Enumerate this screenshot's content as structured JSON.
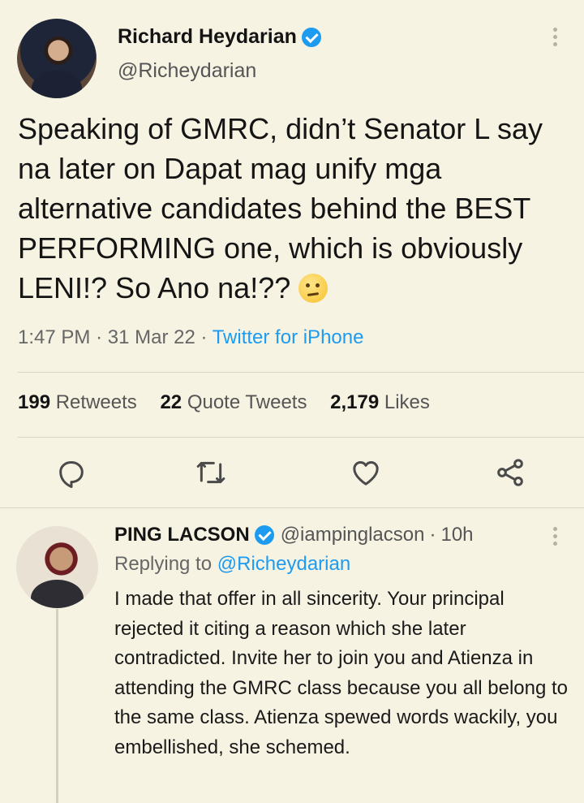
{
  "tweet": {
    "author_name": "Richard Heydarian",
    "author_handle": "@Richeydarian",
    "text": "Speaking of GMRC, didn’t Senator L say na later on Dapat mag unify mga alternative candidates behind the BEST PERFORMING one, which is obviously LENI!? So Ano na!??",
    "emoji": "face-with-rolling-eyes",
    "time": "1:47 PM",
    "date": "31 Mar 22",
    "source": "Twitter for iPhone",
    "separator": "·",
    "stats": {
      "retweets_count": "199",
      "retweets_label": "Retweets",
      "quotes_count": "22",
      "quotes_label": "Quote Tweets",
      "likes_count": "2,179",
      "likes_label": "Likes"
    },
    "actions": [
      "reply-icon",
      "retweet-icon",
      "like-icon",
      "share-icon"
    ]
  },
  "reply": {
    "author_name": "PING LACSON",
    "author_handle": "@iampinglacson",
    "age": "10h",
    "separator": "·",
    "replying_prefix": "Replying to",
    "replying_mention": "@Richeydarian",
    "text": "I made that offer in all sincerity.  Your principal rejected it citing a reason which she later contradicted. Invite her to join you and Atienza in attending the GMRC class because you all belong to the same class. Atienza spewed words wackily, you embellished, she schemed."
  },
  "colors": {
    "background": "#f7f3e3",
    "accent": "#1d9bf0",
    "icon": "#4a4a4a"
  }
}
